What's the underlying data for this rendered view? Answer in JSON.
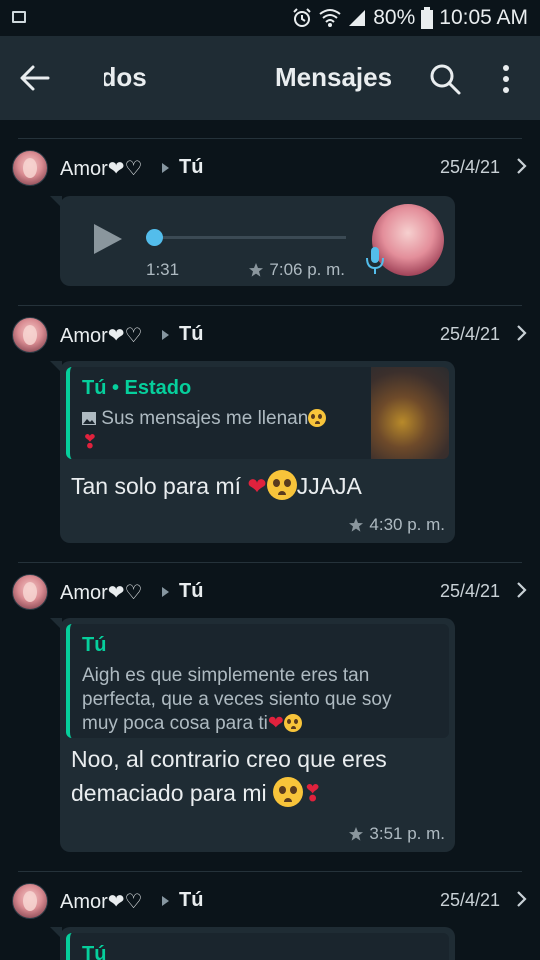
{
  "status_bar": {
    "battery_percent": "80%",
    "time": "10:05 AM",
    "icons": [
      "image-icon",
      "alarm-icon",
      "wifi-icon",
      "signal-icon",
      "battery-icon"
    ]
  },
  "app_bar": {
    "tabs": [
      "Estados",
      "Mensajes"
    ],
    "tab_visible_text": [
      "ados",
      "Mensajes"
    ],
    "icons": [
      "back-arrow-icon",
      "search-icon",
      "more-vert-icon"
    ]
  },
  "accent_color": "#06cf9c",
  "messages": [
    {
      "from": "Amor❤♡",
      "to": "Tú",
      "date": "25/4/21",
      "type": "voice",
      "duration": "1:31",
      "time": "7:06 p. m.",
      "starred": true
    },
    {
      "from": "Amor❤♡",
      "to": "Tú",
      "date": "25/4/21",
      "type": "reply",
      "quote_title": "Tú • Estado",
      "quote_body": "Sus mensajes me llenan",
      "text": "Tan solo para mí",
      "text_suffix": "JJAJA",
      "time": "4:30 p. m.",
      "starred": true
    },
    {
      "from": "Amor❤♡",
      "to": "Tú",
      "date": "25/4/21",
      "type": "reply",
      "quote_title": "Tú",
      "quote_body": "Aigh es que simplemente eres tan perfecta, que a veces siento que soy muy poca cosa para ti",
      "text": "Noo, al contrario creo que eres demaciado para mi",
      "time": "3:51 p. m.",
      "starred": true
    },
    {
      "from": "Amor❤♡",
      "to": "Tú",
      "date": "25/4/21",
      "type": "reply",
      "quote_title": "Tú"
    }
  ]
}
